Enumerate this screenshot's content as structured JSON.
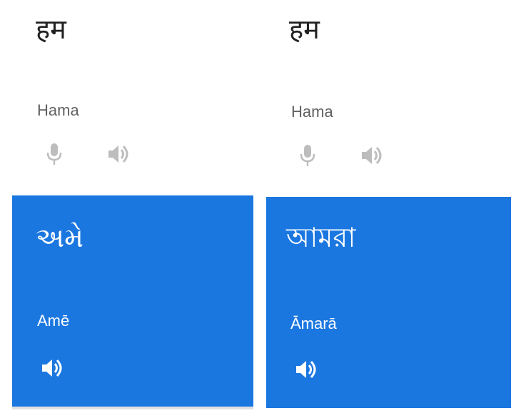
{
  "panels": [
    {
      "source": {
        "word": "हम",
        "transliteration": "Hama"
      },
      "target": {
        "word": "અમે",
        "transliteration": "Amē"
      }
    },
    {
      "source": {
        "word": "हम",
        "transliteration": "Hama"
      },
      "target": {
        "word": "আমরা",
        "transliteration": "Āmarā"
      }
    }
  ],
  "icons": {
    "mic": "microphone-icon",
    "speaker": "speaker-icon"
  },
  "colors": {
    "card_background": "#1b77e0",
    "icon_inactive": "#bdbdbd",
    "text_primary": "#212121",
    "text_secondary": "#616161"
  }
}
